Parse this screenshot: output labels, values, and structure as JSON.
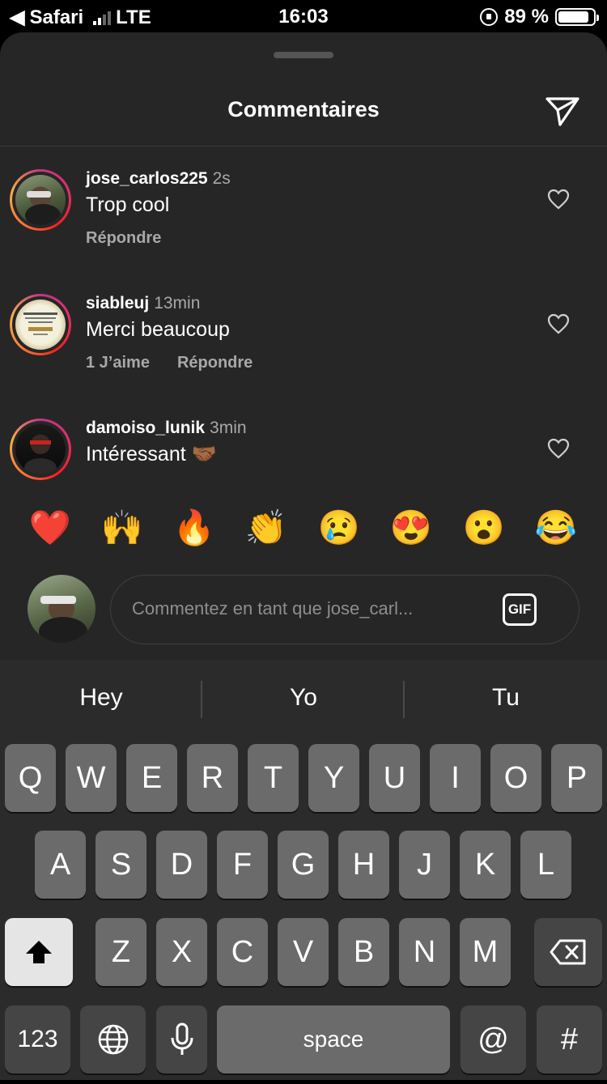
{
  "status_bar": {
    "back_app": "Safari",
    "network": "LTE",
    "time": "16:03",
    "battery": "89 %",
    "battery_level": 0.89
  },
  "sheet": {
    "title": "Commentaires"
  },
  "comments": [
    {
      "user": "jose_carlos225",
      "time": "2s",
      "text": "Trop cool",
      "actions": [
        "Répondre"
      ]
    },
    {
      "user": "siableuj",
      "time": "13min",
      "text": "Merci beaucoup",
      "actions": [
        "1 J’aime",
        "Répondre"
      ]
    },
    {
      "user": "damoiso_lunik",
      "time": "3min",
      "text": "Intéressant 🤝🏾",
      "actions": []
    }
  ],
  "reactions": [
    "❤️",
    "🙌",
    "🔥",
    "👏",
    "😢",
    "😍",
    "😮",
    "😂"
  ],
  "composer": {
    "placeholder": "Commentez en tant que jose_carl...",
    "gif_label": "GIF"
  },
  "keyboard": {
    "suggestions": [
      "Hey",
      "Yo",
      "Tu"
    ],
    "row1": [
      "Q",
      "W",
      "E",
      "R",
      "T",
      "Y",
      "U",
      "I",
      "O",
      "P"
    ],
    "row2": [
      "A",
      "S",
      "D",
      "F",
      "G",
      "H",
      "J",
      "K",
      "L"
    ],
    "row3": [
      "Z",
      "X",
      "C",
      "V",
      "B",
      "N",
      "M"
    ],
    "numbers_label": "123",
    "space_label": "space",
    "at_label": "@",
    "hash_label": "#"
  }
}
